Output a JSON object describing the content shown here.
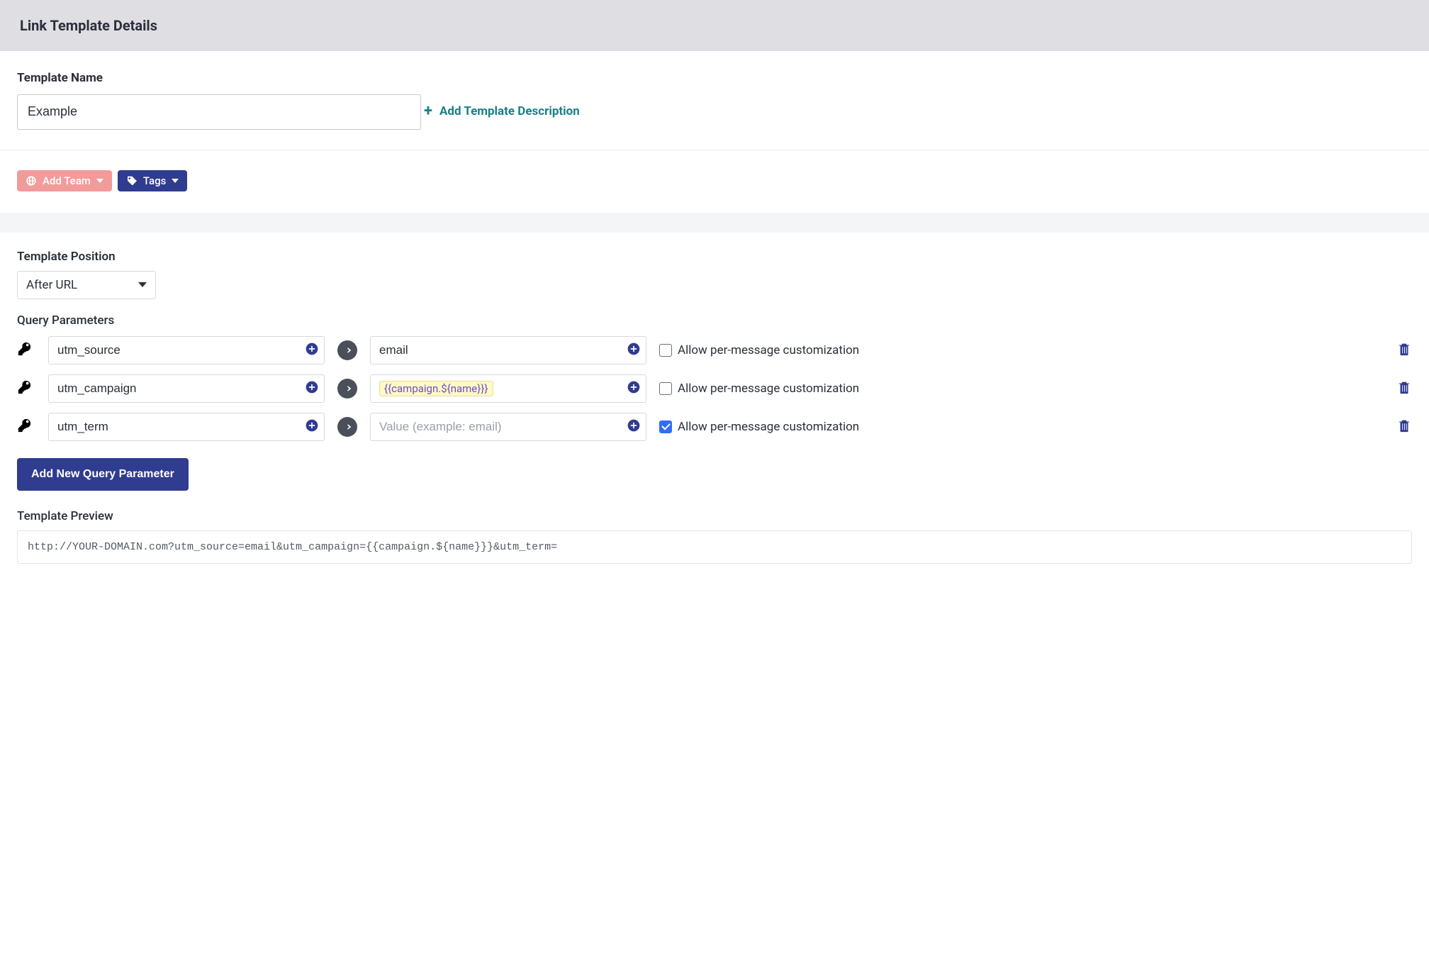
{
  "header": {
    "title": "Link Template Details"
  },
  "name_section": {
    "label": "Template Name",
    "value": "Example",
    "add_desc_label": "Add Template Description"
  },
  "pills": {
    "add_team": "Add Team",
    "tags": "Tags"
  },
  "position": {
    "label": "Template Position",
    "selected": "After URL"
  },
  "qp": {
    "label": "Query Parameters",
    "value_placeholder": "Value (example: email)",
    "allow_label": "Allow per-message customization",
    "rows": [
      {
        "key": "utm_source",
        "value": "email",
        "is_chip": false,
        "allow": false
      },
      {
        "key": "utm_campaign",
        "value": "{{campaign.${name}}}",
        "is_chip": true,
        "allow": false
      },
      {
        "key": "utm_term",
        "value": "",
        "is_chip": false,
        "allow": true
      }
    ],
    "add_button": "Add New Query Parameter"
  },
  "preview": {
    "label": "Template Preview",
    "text": "http://YOUR-DOMAIN.com?utm_source=email&utm_campaign={{campaign.${name}}}&utm_term="
  }
}
